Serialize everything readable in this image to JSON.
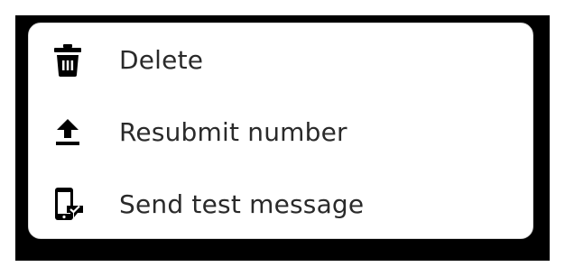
{
  "menu": {
    "items": [
      {
        "label": "Delete",
        "icon": "trash-icon"
      },
      {
        "label": "Resubmit number",
        "icon": "upload-icon"
      },
      {
        "label": "Send test message",
        "icon": "phone-check-icon"
      }
    ]
  }
}
